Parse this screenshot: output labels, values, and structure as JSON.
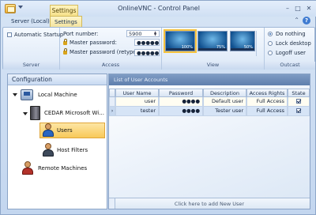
{
  "window": {
    "title": "OnlineVNC - Control Panel"
  },
  "context_tab": {
    "label": "Settings"
  },
  "tabs": [
    {
      "label": "Server (Local)"
    },
    {
      "label": "Settings"
    }
  ],
  "ribbon": {
    "server_group": {
      "label": "Server",
      "automatic_startup": "Automatic Startup"
    },
    "access_group": {
      "label": "Access",
      "port_label": "Port number:",
      "port_value": "5900",
      "master_password_label": "Master password:",
      "master_password_value": "●●●●●",
      "master_password_retype_label": "Master password (retype):",
      "master_password_retype_value": "●●●●●"
    },
    "view_group": {
      "label": "View",
      "thumbnails": [
        {
          "zoom": "100%",
          "selected": true
        },
        {
          "zoom": "75%",
          "selected": false
        },
        {
          "zoom": "50%",
          "selected": false
        }
      ]
    },
    "outcast_group": {
      "label": "Outcast",
      "options": [
        {
          "label": "Do nothing",
          "selected": true
        },
        {
          "label": "Lock desktop",
          "selected": false
        },
        {
          "label": "Logoff user",
          "selected": false
        }
      ]
    }
  },
  "configuration": {
    "title": "Configuration",
    "tree": [
      {
        "label": "Local Machine"
      },
      {
        "label": "CEDAR Microsoft Wi..."
      },
      {
        "label": "Users"
      },
      {
        "label": "Host Filters"
      },
      {
        "label": "Remote Machines"
      }
    ]
  },
  "users_list": {
    "title": "List of User Accounts",
    "columns": [
      "User Name",
      "Password",
      "Description",
      "Access Rights",
      "State"
    ],
    "rows": [
      {
        "user_name": "user",
        "password": "●●●●",
        "description": "Default user",
        "access_rights": "Full Access",
        "state": true
      },
      {
        "user_name": "tester",
        "password": "●●●●",
        "description": "Tester user",
        "access_rights": "Full Access",
        "state": true
      }
    ],
    "add_new_label": "Click here to add New User"
  },
  "colors": {
    "accent": "#f8c95a",
    "header": "#6f8db8"
  }
}
